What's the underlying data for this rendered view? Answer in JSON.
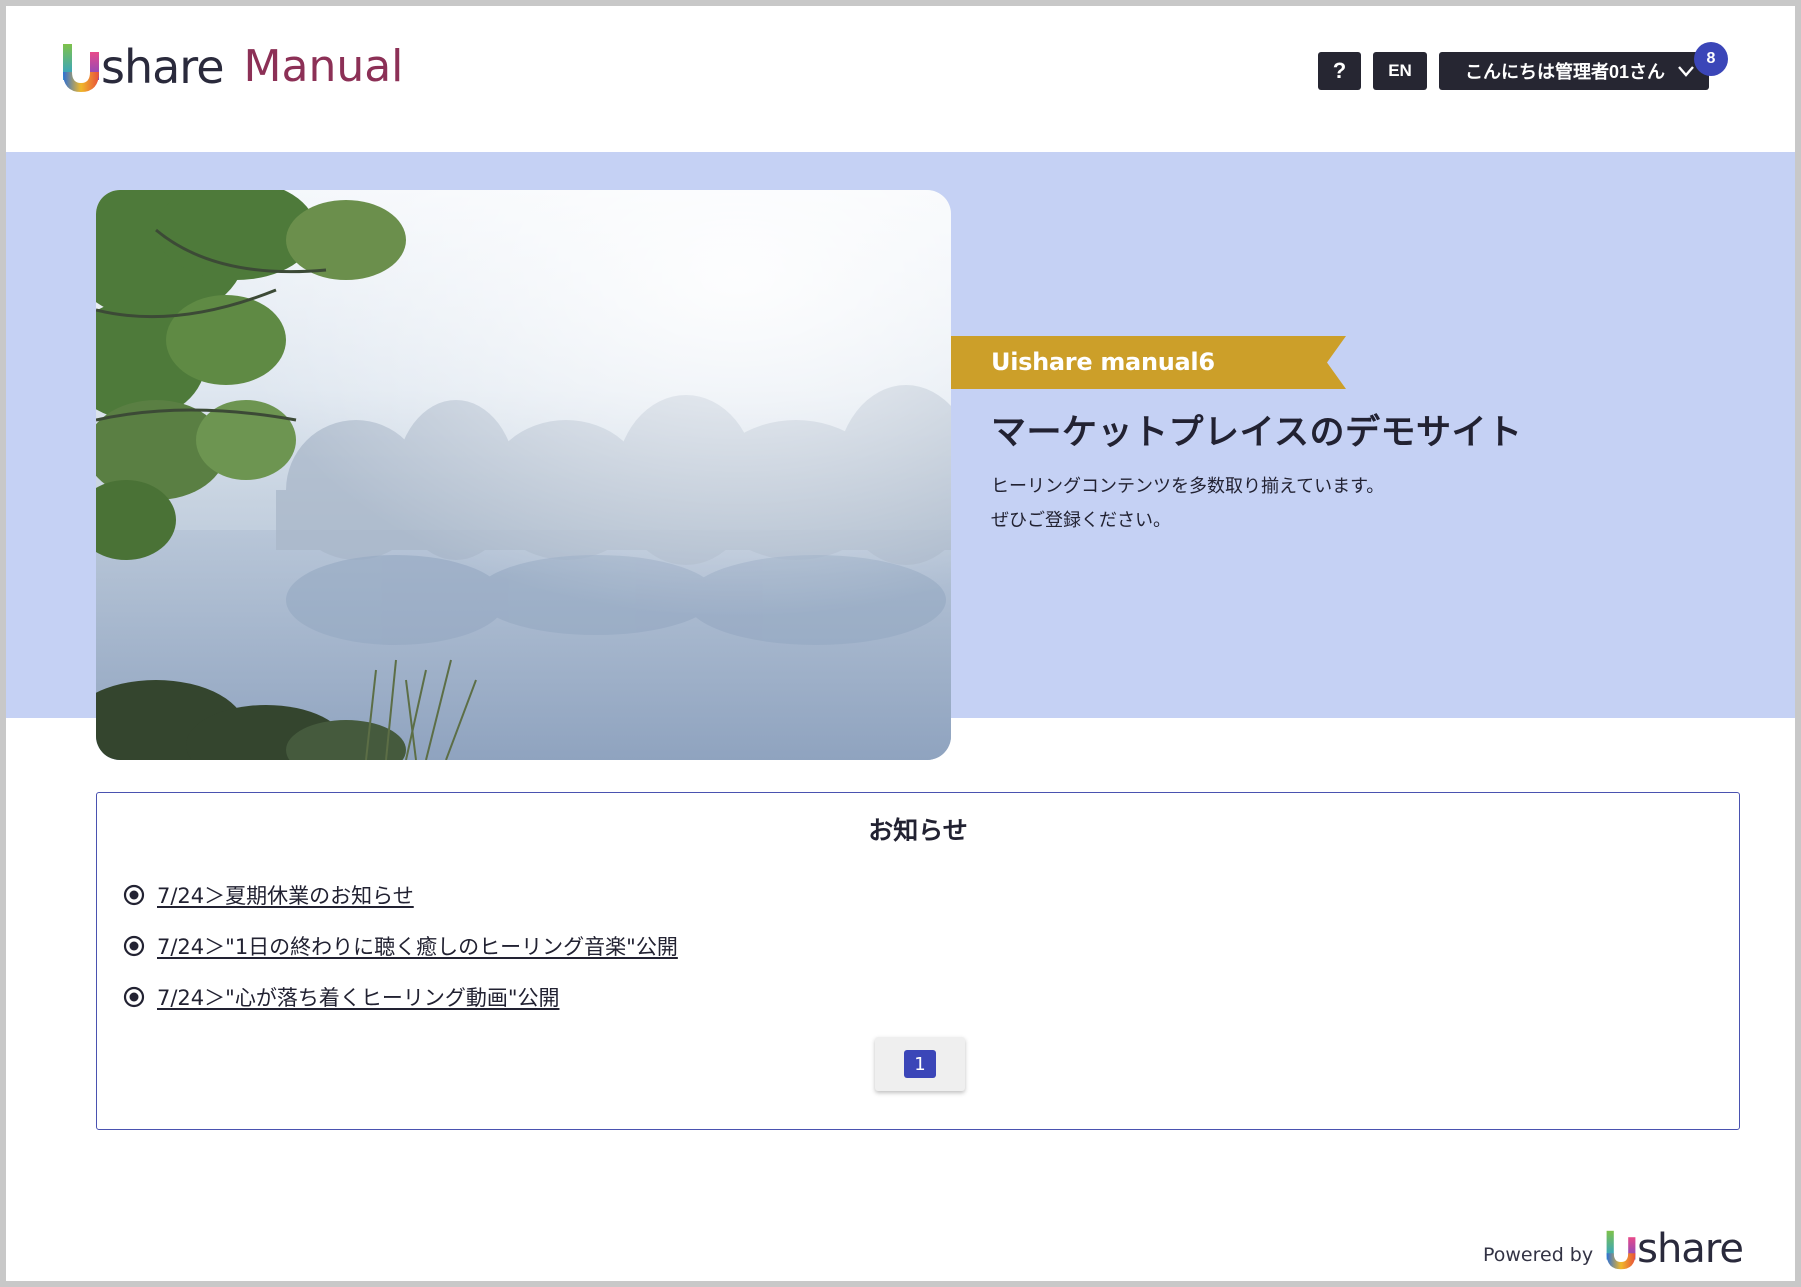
{
  "header": {
    "logo_share": "share",
    "logo_manual": "Manual",
    "help_label": "?",
    "lang_label": "EN",
    "user_greeting": "こんにちは管理者01さん",
    "notification_count": "8"
  },
  "hero": {
    "ribbon_label": "Uishare manual6",
    "title": "マーケットプレイスのデモサイト",
    "description": [
      "ヒーリングコンテンツを多数取り揃えています。",
      "ぜひご登録ください。"
    ]
  },
  "notice": {
    "title": "お知らせ",
    "items": [
      "7/24＞夏期休業のお知らせ",
      "7/24＞\"1日の終わりに聴く癒しのヒーリング音楽\"公開",
      "7/24＞\"心が落ち着くヒーリング動画\"公開"
    ],
    "current_page": "1"
  },
  "footer": {
    "powered_by": "Powered by",
    "brand_share": "share"
  },
  "colors": {
    "hero_band": "#c5d1f4",
    "ribbon": "#cc9f29",
    "accent": "#3b46b8",
    "manual_text": "#8c3056",
    "header_button": "#262632"
  },
  "icons": {
    "logo": "ushare-logo-icon",
    "help": "question-icon",
    "user_menu": "chevron-down-icon",
    "notice_bullet": "radio-bullet-icon"
  }
}
